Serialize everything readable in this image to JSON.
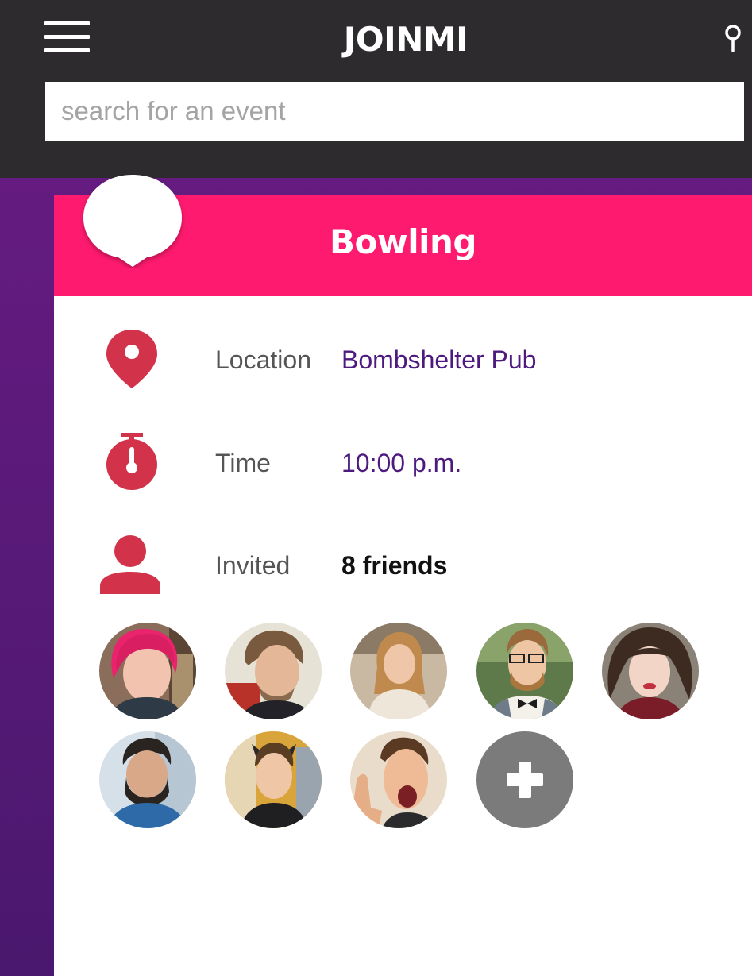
{
  "header": {
    "app_title": "JOINMI",
    "menu_icon": "hamburger-menu-icon",
    "search_icon": "search-icon"
  },
  "search": {
    "placeholder": "search for an event",
    "value": ""
  },
  "event": {
    "title": "Bowling",
    "bubble_icon": "speech-bubble-icon",
    "details": [
      {
        "label": "Location",
        "value": "Bombshelter Pub",
        "icon": "map-pin-icon"
      },
      {
        "label": "Time",
        "value": "10:00 p.m.",
        "icon": "stopwatch-icon"
      },
      {
        "label": "Invited",
        "value": "8 friends",
        "icon": "person-icon"
      }
    ],
    "friends": [
      {
        "avatar": "friend-avatar-1"
      },
      {
        "avatar": "friend-avatar-2"
      },
      {
        "avatar": "friend-avatar-3"
      },
      {
        "avatar": "friend-avatar-4"
      },
      {
        "avatar": "friend-avatar-5"
      },
      {
        "avatar": "friend-avatar-6"
      },
      {
        "avatar": "friend-avatar-7"
      },
      {
        "avatar": "friend-avatar-8"
      }
    ],
    "add_friend_icon": "plus-icon"
  },
  "colors": {
    "topbar": "#2d2b2e",
    "accent_pink": "#fe1a6e",
    "purple": "#5c1a7a",
    "icon_red": "#d2334a",
    "value_purple": "#4d1a80",
    "add_button_gray": "#7b7b7b"
  }
}
